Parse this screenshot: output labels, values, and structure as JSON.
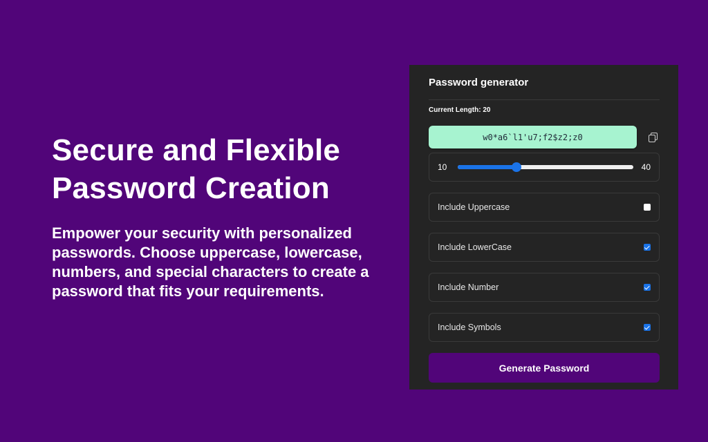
{
  "colors": {
    "background": "#510579",
    "panel": "#242424",
    "password_box": "#a7f3d0",
    "accent": "#1a73e8",
    "button": "#510579"
  },
  "hero": {
    "title_line1": "Secure and Flexible",
    "title_line2": "Password Creation",
    "description": "Empower your security with personalized passwords. Choose uppercase, lowercase, numbers, and special characters to create a password that fits your requirements."
  },
  "generator": {
    "title": "Password generator",
    "current_length_label": "Current Length: 20",
    "password": "w0*a6`l1'u7;f2$z2;z0",
    "copy_icon": "copy-icon",
    "length": {
      "min_label": "10",
      "max_label": "40",
      "min": 10,
      "max": 40,
      "value": 20
    },
    "options": [
      {
        "label": "Include Uppercase",
        "checked": false
      },
      {
        "label": "Include LowerCase",
        "checked": true
      },
      {
        "label": "Include Number",
        "checked": true
      },
      {
        "label": "Include Symbols",
        "checked": true
      }
    ],
    "generate_label": "Generate Password"
  }
}
